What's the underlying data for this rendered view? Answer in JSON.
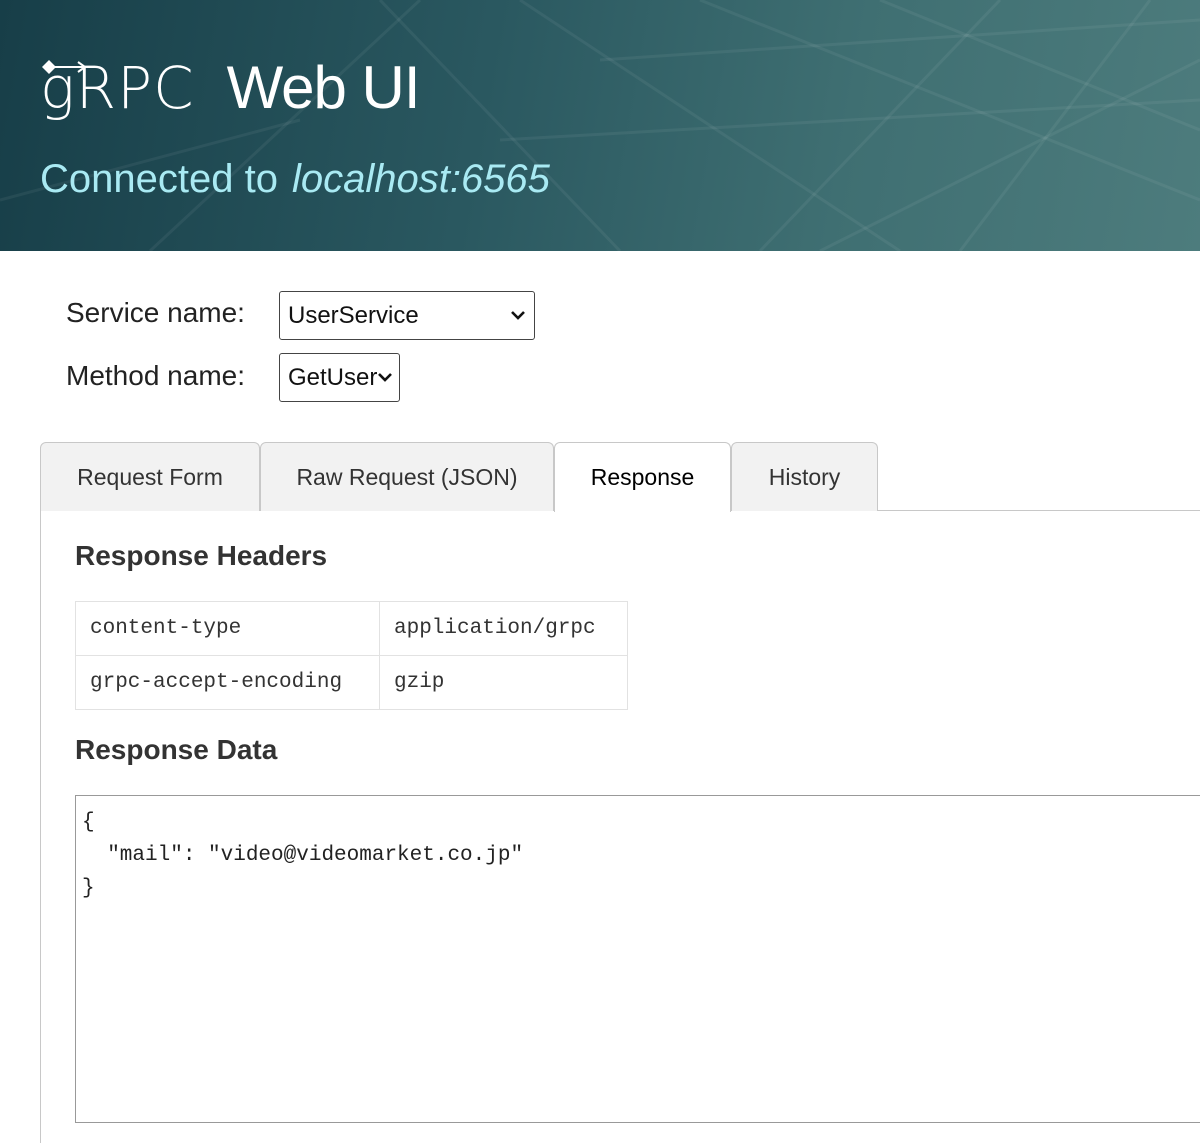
{
  "header": {
    "logo_text": "gRPC",
    "title": "Web UI",
    "connected_prefix": "Connected to",
    "host": "localhost:6565"
  },
  "form": {
    "service_label": "Service name:",
    "service_value": "UserService",
    "method_label": "Method name:",
    "method_value": "GetUser"
  },
  "tabs": [
    {
      "label": "Request Form",
      "active": false
    },
    {
      "label": "Raw Request (JSON)",
      "active": false
    },
    {
      "label": "Response",
      "active": true
    },
    {
      "label": "History",
      "active": false
    }
  ],
  "response": {
    "headers_title": "Response Headers",
    "headers": [
      {
        "key": "content-type",
        "value": "application/grpc"
      },
      {
        "key": "grpc-accept-encoding",
        "value": "gzip"
      }
    ],
    "data_title": "Response Data",
    "data_body": "{\n  \"mail\": \"video@videomarket.co.jp\"\n}"
  },
  "colors": {
    "header_dark": "#173e48",
    "header_light": "#4d7c7d",
    "host_text": "#a9eaf3"
  }
}
